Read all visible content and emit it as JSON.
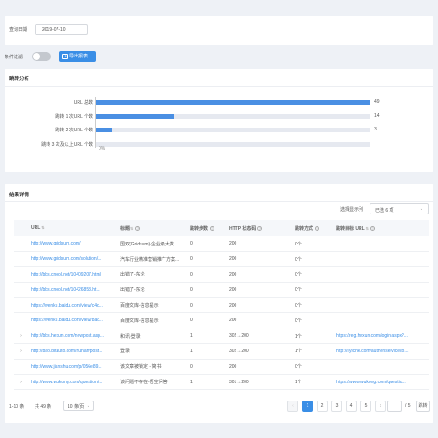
{
  "filter": {
    "date_label": "查询日期",
    "date_value": "2019-07-10"
  },
  "toolbar": {
    "toggle_label": "条件过滤",
    "export_label": "导出报表"
  },
  "chart_section": {
    "title": "跳转分析"
  },
  "chart_data": {
    "type": "bar",
    "orientation": "horizontal",
    "categories": [
      "URL 总数",
      "跳转 1 次URL 个数",
      "跳转 2 次URL 个数",
      "跳转 3 次及以上URL 个数"
    ],
    "values": [
      49,
      14,
      3,
      0
    ],
    "value_labels": [
      "49",
      "14",
      "3",
      "0%"
    ],
    "xlim": [
      0,
      49
    ]
  },
  "table_section": {
    "title": "结果详情",
    "columns_label": "选择显示列",
    "columns_value": "已选 6 项",
    "headers": [
      "URL",
      "标题",
      "跳转步数",
      "HTTP 状态码",
      "跳转方式",
      "跳转目标 URL"
    ],
    "rows": [
      {
        "exp": "",
        "url": "http://www.gridsum.com/",
        "title": "国双(Gridsum)-企业级大数...",
        "steps": "0",
        "http": "200",
        "method": "0个",
        "target": ""
      },
      {
        "exp": "",
        "url": "http://www.gridsum.com/solution/...",
        "title": "汽车行业精准营销推广方案...",
        "steps": "0",
        "http": "200",
        "method": "0个",
        "target": ""
      },
      {
        "exp": "",
        "url": "http://bbs.cnool.net/10409207.html",
        "title": "出错了-东论",
        "steps": "0",
        "http": "200",
        "method": "0个",
        "target": ""
      },
      {
        "exp": "",
        "url": "http://bbs.cnool.net/10426853.ht...",
        "title": "出错了-东论",
        "steps": "0",
        "http": "200",
        "method": "0个",
        "target": ""
      },
      {
        "exp": "",
        "url": "https://wenku.baidu.com/view/c4d...",
        "title": "百度文库-信息提示",
        "steps": "0",
        "http": "200",
        "method": "0个",
        "target": ""
      },
      {
        "exp": "",
        "url": "https://wenku.baidu.com/view/8ac...",
        "title": "百度文库-信息提示",
        "steps": "0",
        "http": "200",
        "method": "0个",
        "target": ""
      },
      {
        "exp": "›",
        "url": "http://bbs.hexun.com/newpost.asp...",
        "title": "和讯-登录",
        "steps": "1",
        "http": "302→200",
        "method": "1个",
        "target": "https://reg.hexun.com/login.aspx?..."
      },
      {
        "exp": "›",
        "url": "http://bao.bitauto.com/hunan/post...",
        "title": "登录",
        "steps": "1",
        "http": "302→200",
        "method": "1个",
        "target": "http://i.yiche.com/authenservice/lo..."
      },
      {
        "exp": "",
        "url": "http://www.jianshu.com/p/056e89...",
        "title": "该文章被锁定 - 简书",
        "steps": "0",
        "http": "200",
        "method": "0个",
        "target": ""
      },
      {
        "exp": "›",
        "url": "http://www.wukong.com/question/...",
        "title": "该问题不存在-悟空问答",
        "steps": "1",
        "http": "301→200",
        "method": "1个",
        "target": "https://www.wukong.com/questio..."
      }
    ]
  },
  "pagination": {
    "range_label": "1-10 条",
    "total_label": "共 49 条",
    "page_size": "10 条/页",
    "prev": "‹",
    "next": "›",
    "pages": [
      "1",
      "2",
      "3",
      "4",
      "5"
    ],
    "current": "1",
    "total_pages": "/ 5",
    "jump_label": "跳转"
  }
}
